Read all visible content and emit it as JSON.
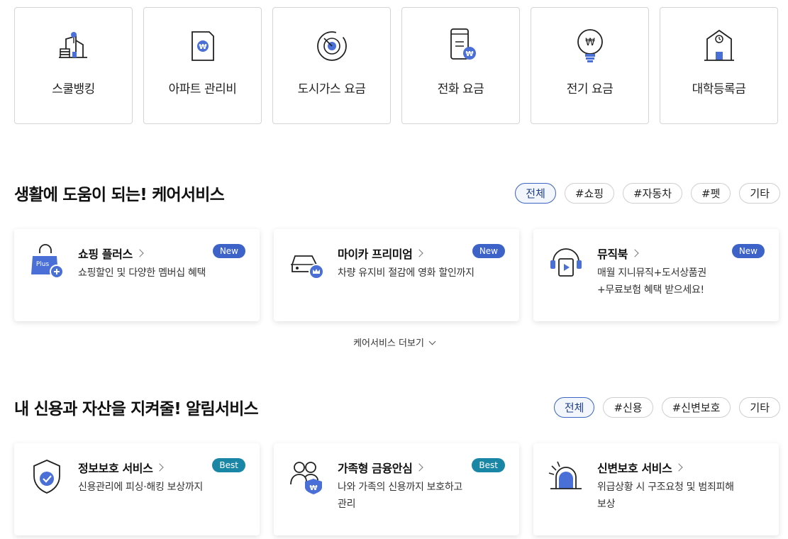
{
  "payments": {
    "items": [
      {
        "label": "스쿨뱅킹",
        "icon": "school-banking-icon"
      },
      {
        "label": "아파트 관리비",
        "icon": "apartment-bill-icon"
      },
      {
        "label": "도시가스 요금",
        "icon": "gas-bill-icon"
      },
      {
        "label": "전화 요금",
        "icon": "phone-bill-icon"
      },
      {
        "label": "전기 요금",
        "icon": "electric-bill-icon"
      },
      {
        "label": "대학등록금",
        "icon": "tuition-icon"
      }
    ]
  },
  "care": {
    "title": "생활에 도움이 되는! 케어서비스",
    "filters": [
      "전체",
      "#쇼핑",
      "#자동차",
      "#펫",
      "기타"
    ],
    "cards": [
      {
        "title": "쇼핑 플러스",
        "desc": "쇼핑할인 및 다양한 멤버십 혜택",
        "badge": "New",
        "icon": "shopping-plus-icon",
        "icon_text": "Plus"
      },
      {
        "title": "마이카 프리미엄",
        "desc": "차량 유지비 절감에 영화 할인까지",
        "badge": "New",
        "icon": "car-premium-icon"
      },
      {
        "title": "뮤직북",
        "desc": "매월 지니뮤직+도서상품권\n+무료보험 혜택 받으세요!",
        "badge": "New",
        "icon": "music-book-icon"
      }
    ],
    "more_label": "케어서비스 더보기"
  },
  "alert": {
    "title": "내 신용과 자산을 지켜줄! 알림서비스",
    "filters": [
      "전체",
      "#신용",
      "#신변보호",
      "기타"
    ],
    "cards": [
      {
        "title": "정보보호 서비스",
        "desc": "신용관리에 피싱·해킹 보상까지",
        "badge": "Best",
        "icon": "shield-check-icon"
      },
      {
        "title": "가족형 금융안심",
        "desc": "나와 가족의 신용까지 보호하고\n관리",
        "badge": "Best",
        "icon": "family-protect-icon"
      },
      {
        "title": "신변보호 서비스",
        "desc": "위급상황 시 구조요청 및 범죄피해\n보상",
        "icon": "siren-icon"
      }
    ]
  },
  "colors": {
    "accent": "#3d63c9",
    "best": "#1a86a6",
    "icon_blue": "#4a6fd6"
  }
}
